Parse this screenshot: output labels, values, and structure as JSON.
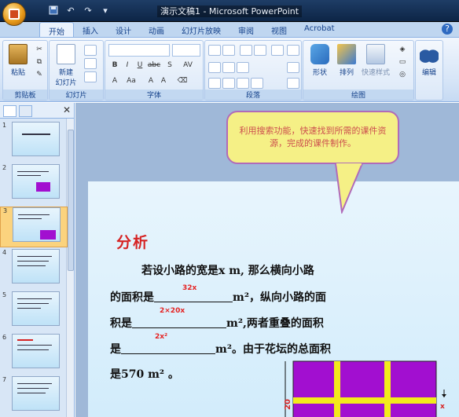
{
  "window": {
    "title": "演示文稿1 - Microsoft PowerPoint"
  },
  "tabs": [
    "开始",
    "插入",
    "设计",
    "动画",
    "幻灯片放映",
    "审阅",
    "视图",
    "Acrobat"
  ],
  "ribbon": {
    "paste": "粘贴",
    "new_slide_line1": "新建",
    "new_slide_line2": "幻灯片",
    "shape": "形状",
    "arrange": "排列",
    "quick_style": "快速样式",
    "edit": "编辑",
    "groups": [
      "剪贴板",
      "幻灯片",
      "字体",
      "段落",
      "绘图"
    ]
  },
  "slides_panel": {
    "numbers": [
      "1",
      "2",
      "3",
      "4",
      "5",
      "6",
      "7"
    ],
    "selected": "3"
  },
  "callout": {
    "text": "利用搜索功能，快速找到所需的课件资源，完成的课件制作。"
  },
  "slide": {
    "heading": "分析",
    "line1": "若设小路的宽是x m, 那么横向小路",
    "line2_a": "的面积是",
    "line2_b": "m²，纵向小路的面",
    "line3_a": "积是",
    "line3_b": "m²,两者重叠的面积",
    "line4_a": "是",
    "line4_b": "m²。由于花坛的总面积",
    "line5": "是570 m² 。",
    "ann1": "32x",
    "ann2": "2×20x",
    "ann3": "2x²",
    "dim_side": "20",
    "dim_right": "x"
  },
  "colors": {
    "accent": "#d62323",
    "callout_bg": "#f5f086",
    "callout_border": "#b06bb9",
    "garden": "#a20fd0",
    "road": "#f3ea1c"
  }
}
